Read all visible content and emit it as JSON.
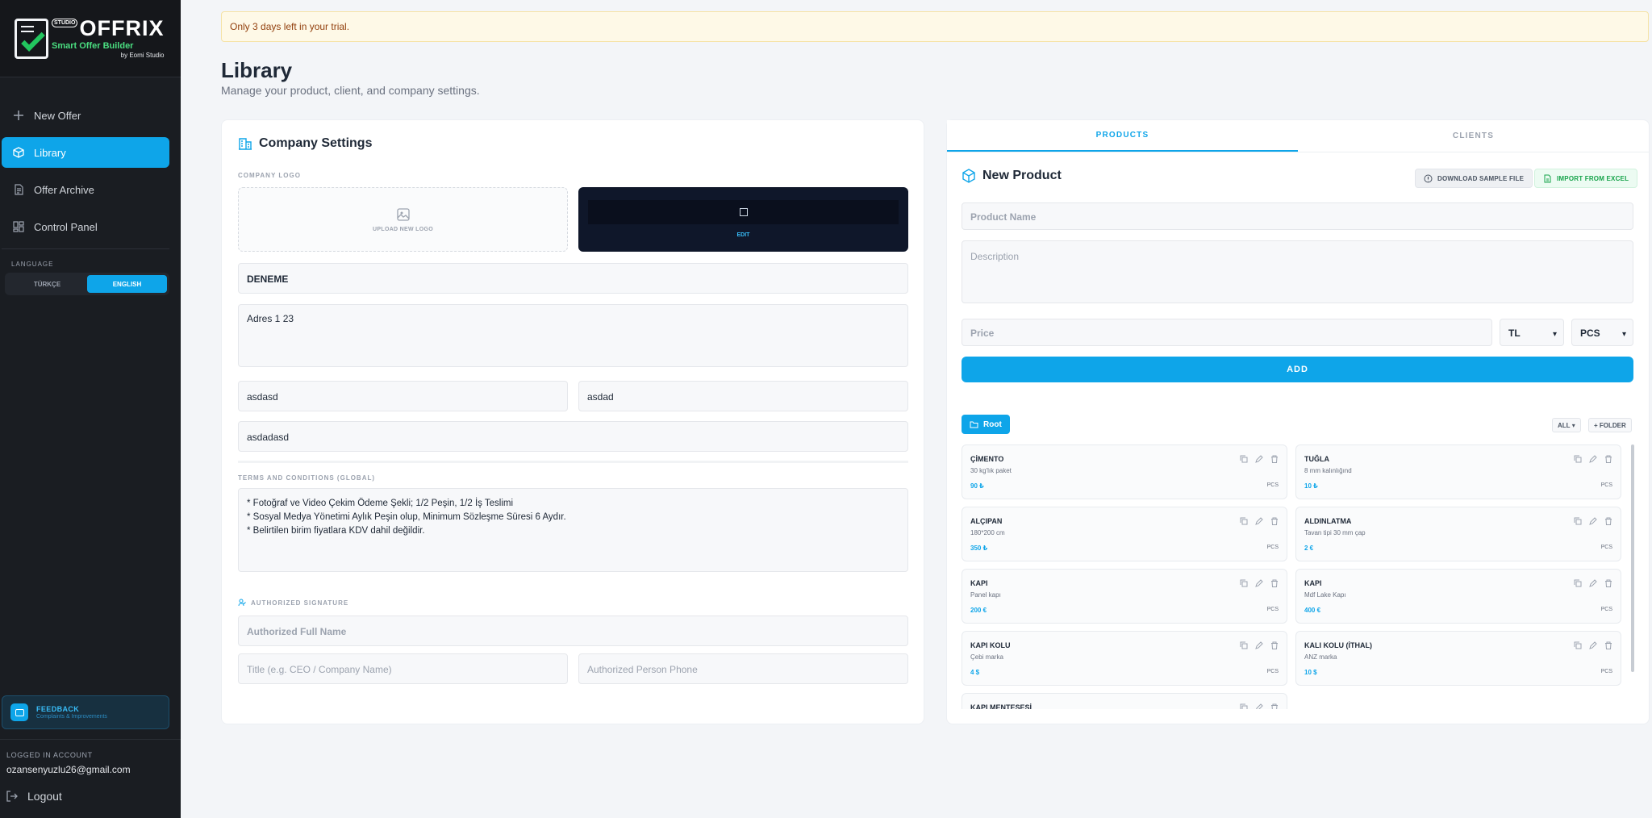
{
  "brand": {
    "badge": "STUDIO",
    "name": "OFFRIX",
    "subtitle": "Smart Offer Builder",
    "by": "by Eomi Studio"
  },
  "sidebar": {
    "items": [
      {
        "label": "New Offer",
        "icon": "plus-icon"
      },
      {
        "label": "Library",
        "icon": "box-icon"
      },
      {
        "label": "Offer Archive",
        "icon": "document-icon"
      },
      {
        "label": "Control Panel",
        "icon": "grid-icon"
      }
    ],
    "language_label": "LANGUAGE",
    "languages": [
      "TÜRKÇE",
      "ENGLISH"
    ],
    "selected_language": "ENGLISH",
    "feedback_title": "FEEDBACK",
    "feedback_sub": "Complaints & Improvements",
    "account_label": "LOGGED IN ACCOUNT",
    "account_email": "ozansenyuzlu26@gmail.com",
    "logout_label": "Logout"
  },
  "trial_banner": "Only 3 days left in your trial.",
  "page": {
    "title": "Library",
    "subtitle": "Manage your product, client, and company settings."
  },
  "company": {
    "title": "Company Settings",
    "logo_label": "COMPANY LOGO",
    "upload_label": "UPLOAD NEW LOGO",
    "edit_label": "EDIT",
    "name": "DENEME",
    "address": "Adres 1 23",
    "field_a": "asdasd",
    "field_b": "asdad",
    "field_c": "asdadasd",
    "terms_label": "TERMS AND CONDITIONS (GLOBAL)",
    "terms": [
      "* Fotoğraf ve Video Çekim Ödeme Şekli; 1/2 Peşin, 1/2 İş Teslimi",
      "* Sosyal Medya Yönetimi Aylık Peşin olup, Minimum Sözleşme Süresi 6 Aydır.",
      "* Belirtilen birim fiyatlara KDV dahil değildir."
    ],
    "signature_label": "AUTHORIZED SIGNATURE",
    "signature_name_placeholder": "Authorized Full Name",
    "signature_title_placeholder": "Title (e.g. CEO / Company Name)",
    "signature_phone_placeholder": "Authorized Person Phone"
  },
  "products": {
    "tabs": [
      "PRODUCTS",
      "CLIENTS"
    ],
    "active_tab": "PRODUCTS",
    "new_title": "New Product",
    "download_label": "DOWNLOAD SAMPLE FILE",
    "import_label": "IMPORT FROM EXCEL",
    "name_placeholder": "Product Name",
    "description_placeholder": "Description",
    "price_placeholder": "Price",
    "currency": "TL",
    "unit": "PCS",
    "add_label": "ADD",
    "root_label": "Root",
    "filter": "ALL",
    "folder_label": "+ FOLDER",
    "list": [
      {
        "name": "ÇİMENTO",
        "desc": "30 kg'lık paket",
        "price": "90 ₺",
        "unit": "PCS"
      },
      {
        "name": "TUĞLA",
        "desc": "8 mm kalınlığınd",
        "price": "10 ₺",
        "unit": "PCS"
      },
      {
        "name": "ALÇIPAN",
        "desc": "180*200 cm",
        "price": "350 ₺",
        "unit": "PCS"
      },
      {
        "name": "ALDINLATMA",
        "desc": "Tavan tipi 30 mm çap",
        "price": "2 €",
        "unit": "PCS"
      },
      {
        "name": "KAPI",
        "desc": "Panel kapı",
        "price": "200 €",
        "unit": "PCS"
      },
      {
        "name": "KAPI",
        "desc": "Mdf Lake Kapı",
        "price": "400 €",
        "unit": "PCS"
      },
      {
        "name": "KAPI KOLU",
        "desc": "Çebi marka",
        "price": "4 $",
        "unit": "PCS"
      },
      {
        "name": "KALI KOLU (İTHAL)",
        "desc": "ANZ marka",
        "price": "10 $",
        "unit": "PCS"
      },
      {
        "name": "KAPI MENTEŞESİ",
        "desc": "",
        "price": "",
        "unit": ""
      }
    ]
  },
  "colors": {
    "accent": "#0ea5e9",
    "sidebar_bg": "#1a1d22",
    "success": "#16a34a",
    "trial_bg": "#fef9e7"
  }
}
